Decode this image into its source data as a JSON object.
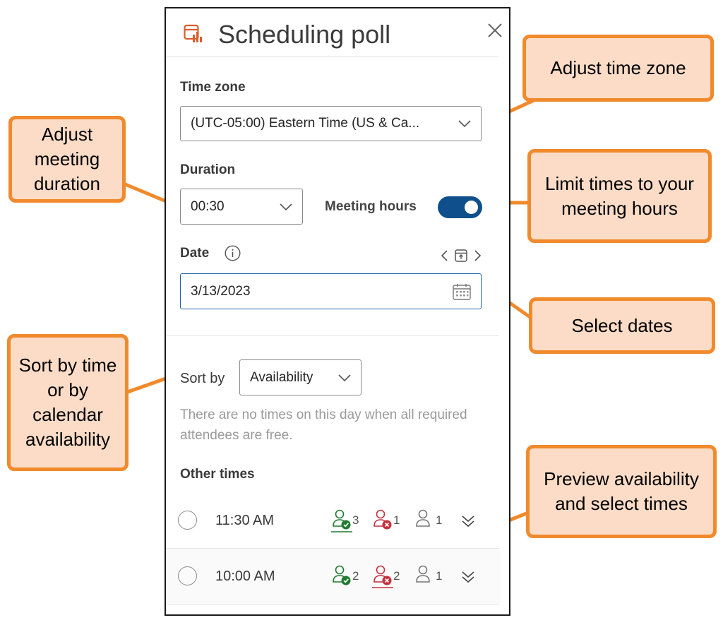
{
  "panel": {
    "title": "Scheduling poll",
    "time_zone_label": "Time zone",
    "time_zone_value": "(UTC-05:00) Eastern Time (US & Ca...",
    "duration_label": "Duration",
    "duration_value": "00:30",
    "meeting_hours_label": "Meeting hours",
    "meeting_hours_on": true,
    "date_label": "Date",
    "date_value": "3/13/2023",
    "sort_by_label": "Sort by",
    "sort_by_value": "Availability",
    "no_times_note": "There are no times on this day when all required attendees are free.",
    "other_times_label": "Other times",
    "times": [
      {
        "time": "11:30 AM",
        "available": "3",
        "unavailable": "1",
        "unknown": "1"
      },
      {
        "time": "10:00 AM",
        "available": "2",
        "unavailable": "2",
        "unknown": "1"
      }
    ]
  },
  "callouts": {
    "time_zone": "Adjust time zone",
    "duration": "Adjust meeting duration",
    "meeting_hours": "Limit times to your meeting hours",
    "dates": "Select dates",
    "sort": "Sort by time or by calendar availability",
    "preview": "Preview availability and select times"
  },
  "colors": {
    "accent": "#0f4f8c",
    "callout_border": "#f08a2c",
    "callout_fill": "#fcdcc6",
    "available": "#1f7a2f",
    "unavailable": "#c4313b",
    "icon_orange": "#d95f2b"
  }
}
